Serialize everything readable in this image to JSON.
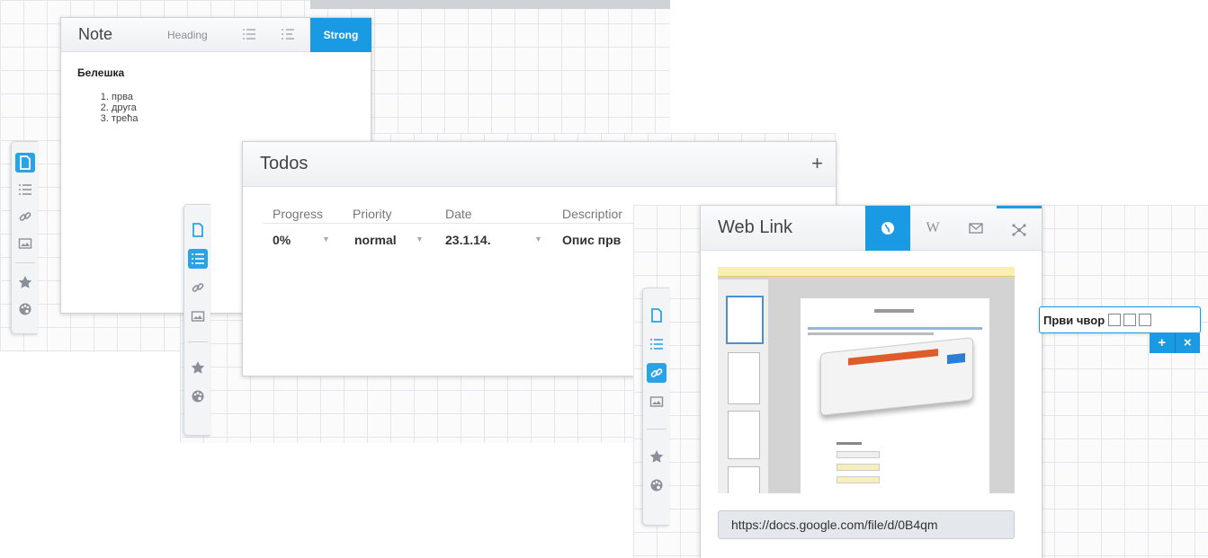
{
  "note": {
    "title": "Note",
    "btn_heading": "Heading",
    "btn_strong": "Strong",
    "body_title": "Белешка",
    "list": [
      "прва",
      "друга",
      "трећа"
    ]
  },
  "todos": {
    "title": "Todos",
    "add_symbol": "+",
    "headers": {
      "progress": "Progress",
      "priority": "Priority",
      "date": "Date",
      "description": "Descriptior"
    },
    "row": {
      "progress": "0%",
      "priority": "normal",
      "date": "23.1.14.",
      "description": "Опис прв"
    }
  },
  "weblink": {
    "title": "Web Link",
    "wiki_letter": "W",
    "url": "https://docs.google.com/file/d/0B4qm"
  },
  "mindmap": {
    "node_label": "Први чвор",
    "add_symbol": "+",
    "close_symbol": "×"
  },
  "colors": {
    "accent": "#1b9ae4",
    "grid": "#e4e6ea"
  },
  "icons": [
    "note-icon",
    "list-icon",
    "link-icon",
    "image-icon",
    "star-icon",
    "palette-icon"
  ]
}
